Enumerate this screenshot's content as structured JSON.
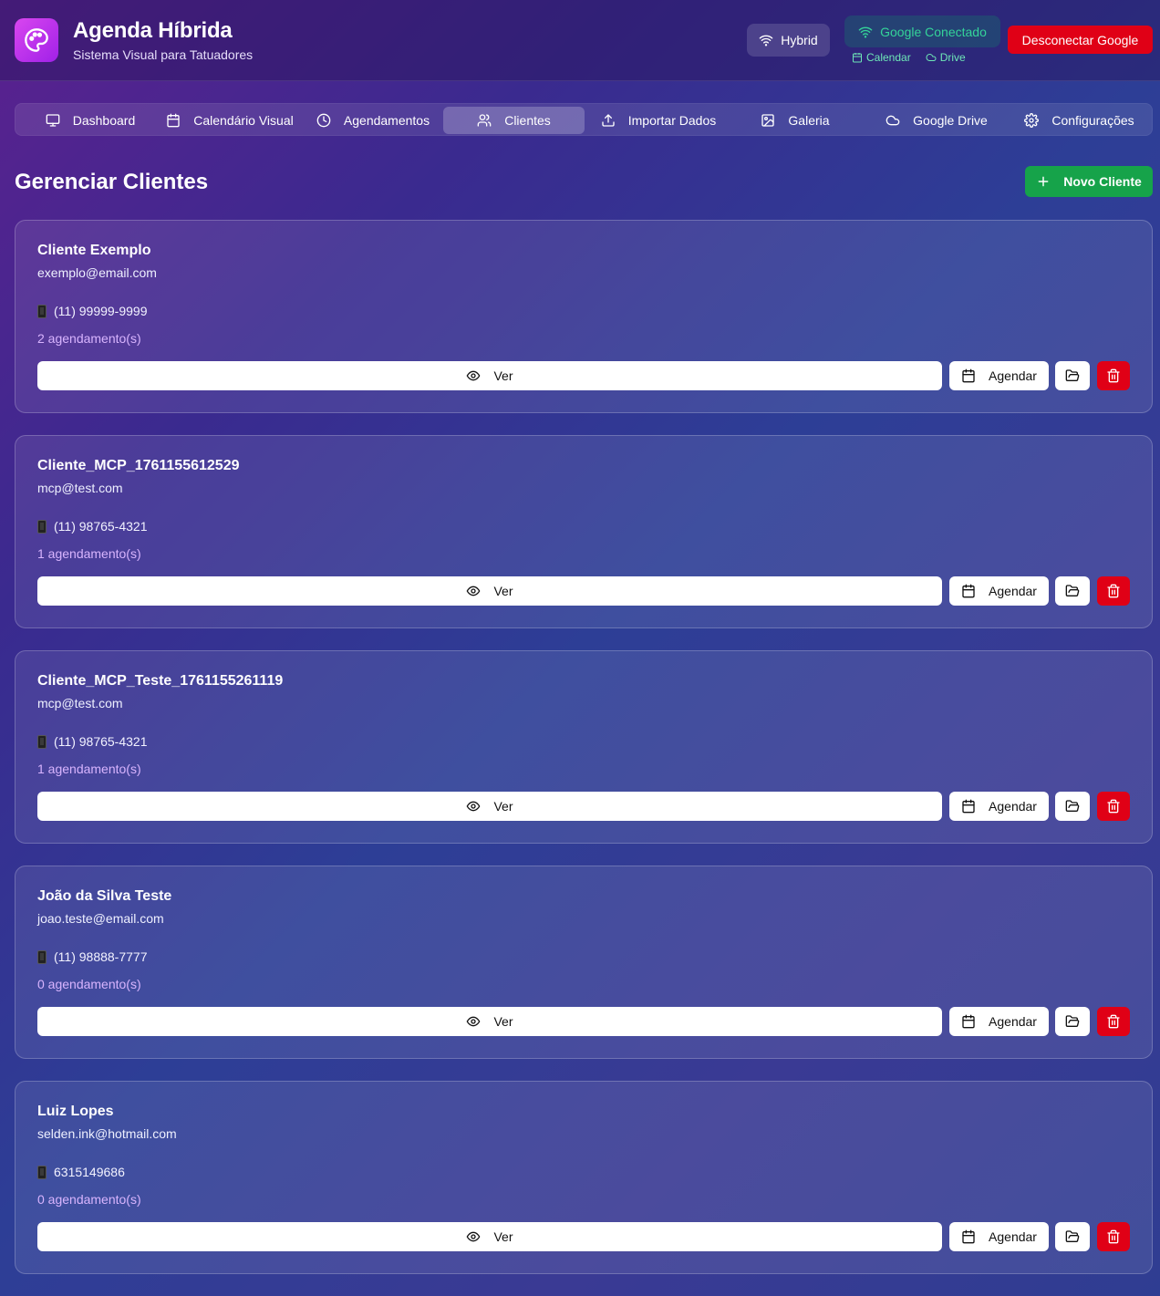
{
  "header": {
    "title": "Agenda Híbrida",
    "subtitle": "Sistema Visual para Tatuadores",
    "mode_label": "Hybrid",
    "google_status": "Google Conectado",
    "google_services": [
      "Calendar",
      "Drive"
    ],
    "disconnect_label": "Desconectar Google"
  },
  "nav": {
    "tabs": [
      {
        "label": "Dashboard",
        "icon": "monitor-icon"
      },
      {
        "label": "Calendário Visual",
        "icon": "calendar-icon"
      },
      {
        "label": "Agendamentos",
        "icon": "clock-icon"
      },
      {
        "label": "Clientes",
        "icon": "users-icon",
        "active": true
      },
      {
        "label": "Importar Dados",
        "icon": "upload-icon"
      },
      {
        "label": "Galeria",
        "icon": "image-icon"
      },
      {
        "label": "Google Drive",
        "icon": "cloud-icon"
      },
      {
        "label": "Configurações",
        "icon": "gear-icon"
      }
    ]
  },
  "main": {
    "title": "Gerenciar Clientes",
    "new_client_label": "Novo Cliente",
    "view_label": "Ver",
    "schedule_label": "Agendar",
    "phone_icon": "📱",
    "clients": [
      {
        "name": "Cliente Exemplo",
        "email": "exemplo@email.com",
        "phone": "(11) 99999-9999",
        "appointments": "2 agendamento(s)"
      },
      {
        "name": "Cliente_MCP_1761155612529",
        "email": "mcp@test.com",
        "phone": "(11) 98765-4321",
        "appointments": "1 agendamento(s)"
      },
      {
        "name": "Cliente_MCP_Teste_1761155261119",
        "email": "mcp@test.com",
        "phone": "(11) 98765-4321",
        "appointments": "1 agendamento(s)"
      },
      {
        "name": "João da Silva Teste",
        "email": "joao.teste@email.com",
        "phone": "(11) 98888-7777",
        "appointments": "0 agendamento(s)"
      },
      {
        "name": "Luiz Lopes",
        "email": "selden.ink@hotmail.com",
        "phone": "6315149686",
        "appointments": "0 agendamento(s)"
      }
    ]
  },
  "colors": {
    "accent_green": "#16a34a",
    "danger_red": "#e00016",
    "status_green": "#34d399",
    "count_purple": "#d8b4fe"
  }
}
